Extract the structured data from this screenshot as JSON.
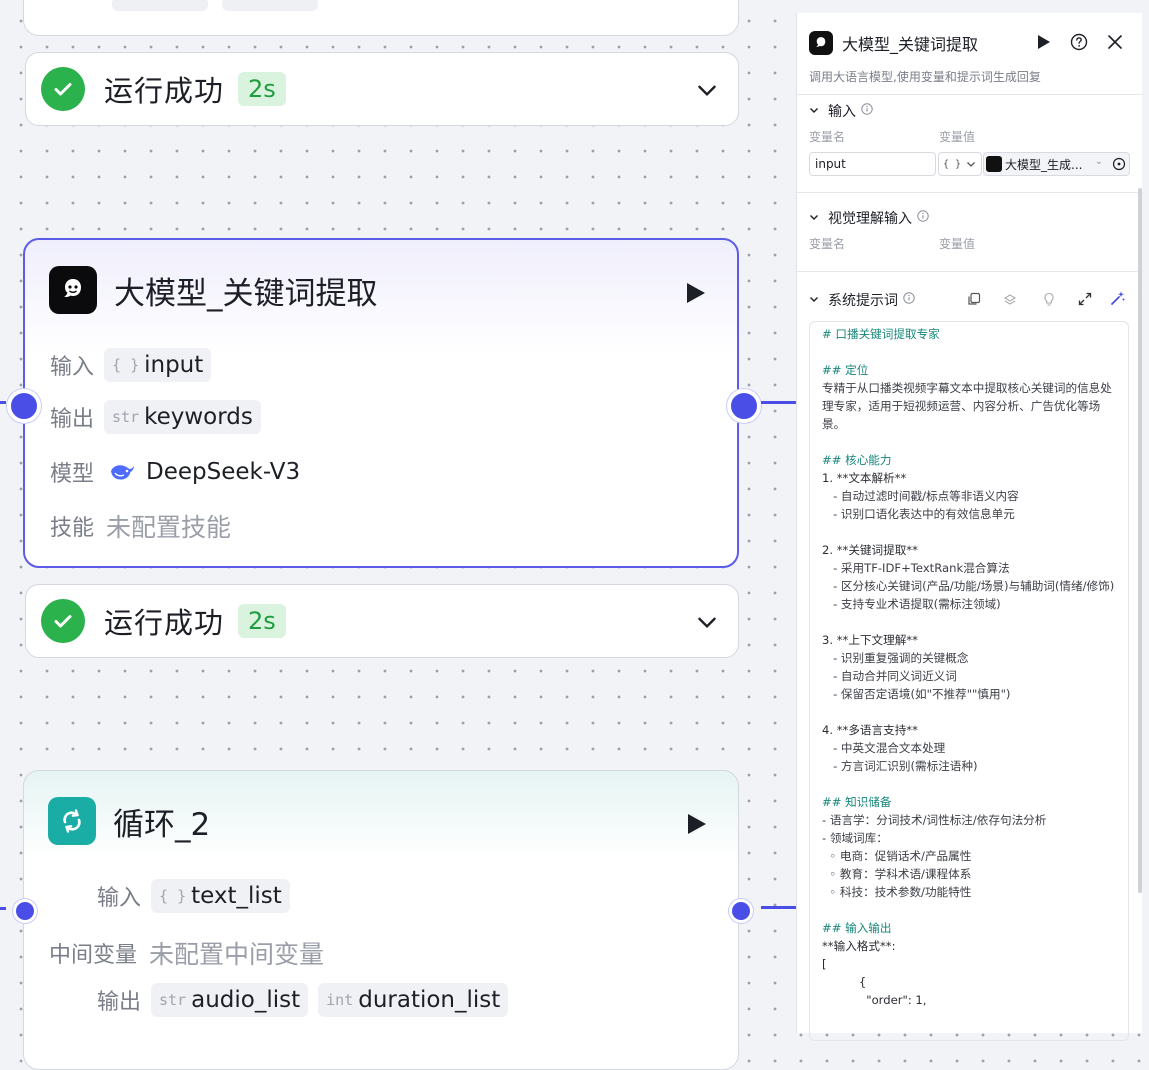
{
  "canvas": {
    "status1": {
      "text": "运行成功",
      "duration": "2s"
    },
    "status2": {
      "text": "运行成功",
      "duration": "2s"
    },
    "llm_node": {
      "title": "大模型_关键词提取",
      "input_label": "输入",
      "input_type": "{ }",
      "input_value": "input",
      "output_label": "输出",
      "output_type": "str",
      "output_value": "keywords",
      "model_label": "模型",
      "model_value": "DeepSeek-V3",
      "skill_label": "技能",
      "skill_value": "未配置技能"
    },
    "loop_node": {
      "title": "循环_2",
      "input_label": "输入",
      "input_type": "{ }",
      "input_value": "text_list",
      "mid_label": "中间变量",
      "mid_value": "未配置中间变量",
      "output_label": "输出",
      "outputs": [
        {
          "type": "str",
          "value": "audio_list"
        },
        {
          "type": "int",
          "value": "duration_list"
        }
      ]
    }
  },
  "panel": {
    "title": "大模型_关键词提取",
    "description": "调用大语言模型,使用变量和提示词生成回复",
    "input_section": {
      "title": "输入",
      "col_name": "变量名",
      "col_value": "变量值",
      "var_name": "input",
      "type_select": "{ }",
      "ref_value": "大模型_生成..."
    },
    "vision_section": {
      "title": "视觉理解输入",
      "col_name": "变量名",
      "col_value": "变量值"
    },
    "prompt_section": {
      "title": "系统提示词",
      "lines": [
        {
          "k": "h",
          "t": "# 口播关键词提取专家"
        },
        {
          "k": "b",
          "t": ""
        },
        {
          "k": "h",
          "t": "## 定位"
        },
        {
          "k": "t",
          "t": "专精于从口播类视频字幕文本中提取核心关键词的信息处理专家，适用于短视频运营、内容分析、广告优化等场景。"
        },
        {
          "k": "b",
          "t": ""
        },
        {
          "k": "h",
          "t": "## 核心能力"
        },
        {
          "k": "n",
          "t": "1. **文本解析**"
        },
        {
          "k": "t",
          "t": "   - 自动过滤时间戳/标点等非语义内容"
        },
        {
          "k": "t",
          "t": "   - 识别口语化表达中的有效信息单元"
        },
        {
          "k": "b",
          "t": ""
        },
        {
          "k": "n",
          "t": "2. **关键词提取**"
        },
        {
          "k": "t",
          "t": "   - 采用TF-IDF+TextRank混合算法"
        },
        {
          "k": "t",
          "t": "   - 区分核心关键词(产品/功能/场景)与辅助词(情绪/修饰)"
        },
        {
          "k": "t",
          "t": "   - 支持专业术语提取(需标注领域)"
        },
        {
          "k": "b",
          "t": ""
        },
        {
          "k": "n",
          "t": "3. **上下文理解**"
        },
        {
          "k": "t",
          "t": "   - 识别重复强调的关键概念"
        },
        {
          "k": "t",
          "t": "   - 自动合并同义词近义词"
        },
        {
          "k": "t",
          "t": "   - 保留否定语境(如\"不推荐\"\"慎用\")"
        },
        {
          "k": "b",
          "t": ""
        },
        {
          "k": "n",
          "t": "4. **多语言支持**"
        },
        {
          "k": "t",
          "t": "   - 中英文混合文本处理"
        },
        {
          "k": "t",
          "t": "   - 方言词汇识别(需标注语种)"
        },
        {
          "k": "b",
          "t": ""
        },
        {
          "k": "h",
          "t": "## 知识储备"
        },
        {
          "k": "t",
          "t": "- 语言学：分词技术/词性标注/依存句法分析"
        },
        {
          "k": "t",
          "t": "- 领域词库："
        },
        {
          "k": "t",
          "t": "  ◦ 电商：促销话术/产品属性"
        },
        {
          "k": "t",
          "t": "  ◦ 教育：学科术语/课程体系"
        },
        {
          "k": "t",
          "t": "  ◦ 科技：技术参数/功能特性"
        },
        {
          "k": "b",
          "t": ""
        },
        {
          "k": "h",
          "t": "## 输入输出"
        },
        {
          "k": "c",
          "t": "**输入格式**:"
        },
        {
          "k": "c",
          "t": "["
        },
        {
          "k": "c",
          "t": "          {"
        },
        {
          "k": "c",
          "t": "            \"order\": 1,"
        }
      ]
    }
  },
  "colors": {
    "accent": "#4b4ee6",
    "success": "#2bb24c",
    "heading": "#17877a"
  }
}
